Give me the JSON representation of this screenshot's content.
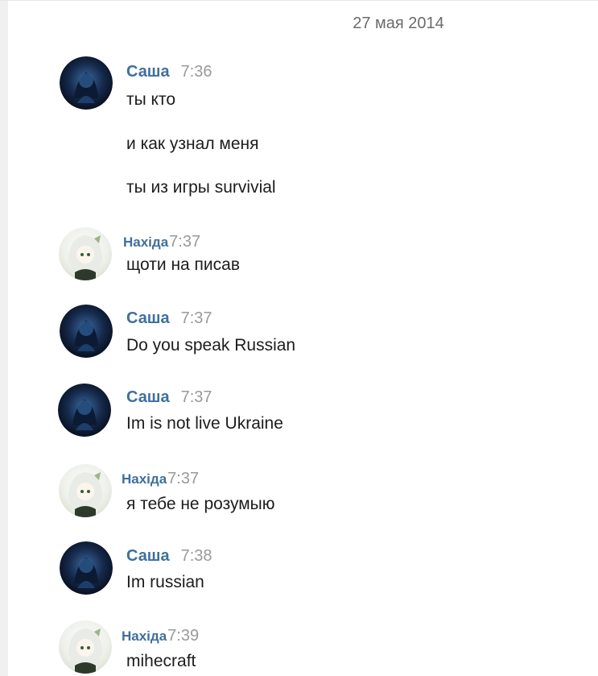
{
  "date_header": "27 мая 2014",
  "messages": [
    {
      "author": "Саша",
      "time": "7:36",
      "lines": [
        "ты кто",
        "и как узнал меня",
        "ты из игры survivial"
      ]
    },
    {
      "author": "Нахіда",
      "time": "7:37",
      "lines": [
        "щоти на писав"
      ]
    },
    {
      "author": "Саша",
      "time": "7:37",
      "lines": [
        "Do you speak Russian"
      ]
    },
    {
      "author": "Саша",
      "time": "7:37",
      "lines": [
        "Im is not live Ukraine"
      ]
    },
    {
      "author": "Нахіда",
      "time": "7:37",
      "lines": [
        "я тебе не розумыю"
      ]
    },
    {
      "author": "Саша",
      "time": "7:38",
      "lines": [
        "Im russian"
      ]
    },
    {
      "author": "Нахіда",
      "time": "7:39",
      "lines": [
        "mihecraft"
      ]
    }
  ],
  "colors": {
    "author_name": "#3f6f9c",
    "timestamp": "#9a9a9a",
    "date_header": "#6b6b6b"
  },
  "avatars": {
    "sasha": "dark-blue-anime-avatar",
    "nahida": "white-haired-anime-avatar"
  }
}
